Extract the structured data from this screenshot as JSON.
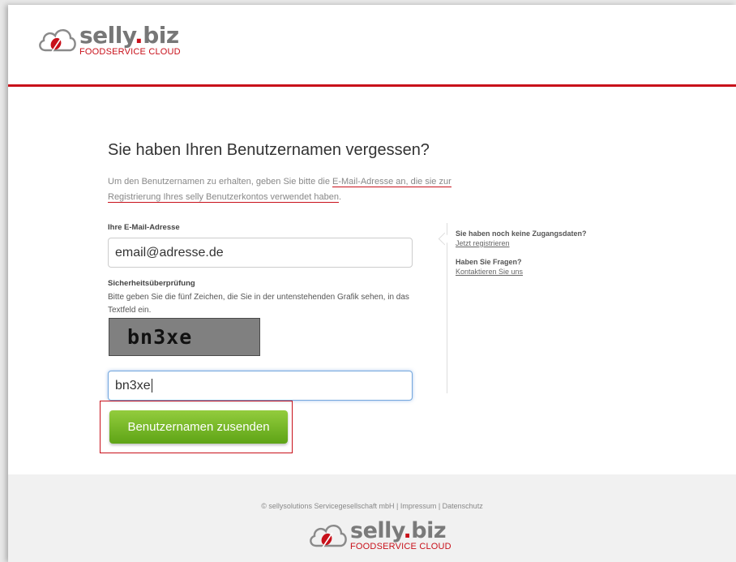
{
  "brand": {
    "name_main": "selly",
    "name_dot": ".",
    "name_tld": "biz",
    "tagline": "FOODSERVICE CLOUD"
  },
  "form": {
    "heading": "Sie haben Ihren Benutzernamen vergessen?",
    "intro_plain": "Um den Benutzernamen zu erhalten, geben Sie bitte die ",
    "intro_link_1": "E-Mail-Adresse an, die sie zur",
    "intro_link_2": "Registrierung Ihres selly Benutzerkontos verwendet haben",
    "intro_end": ".",
    "email_label": "Ihre E-Mail-Adresse",
    "email_value": "email@adresse.de",
    "security_label": "Sicherheitsüberprüfung",
    "security_hint": "Bitte geben Sie die fünf Zeichen, die Sie in der untenstehenden Grafik sehen, in das Textfeld ein.",
    "captcha_text": "bn3xe",
    "captcha_value": "bn3xe",
    "submit_label": "Benutzernamen zusenden"
  },
  "sidebar": {
    "q1": "Sie haben noch keine Zugangsdaten?",
    "a1": "Jetzt registrieren",
    "q2": "Haben Sie Fragen?",
    "a2": "Kontaktieren Sie uns"
  },
  "footer": {
    "text": "© sellysolutions Servicegesellschaft mbH | Impressum | Datenschutz"
  },
  "colors": {
    "accent_red": "#c8101a",
    "button_green": "#6bb321",
    "brand_gray": "#777777"
  }
}
